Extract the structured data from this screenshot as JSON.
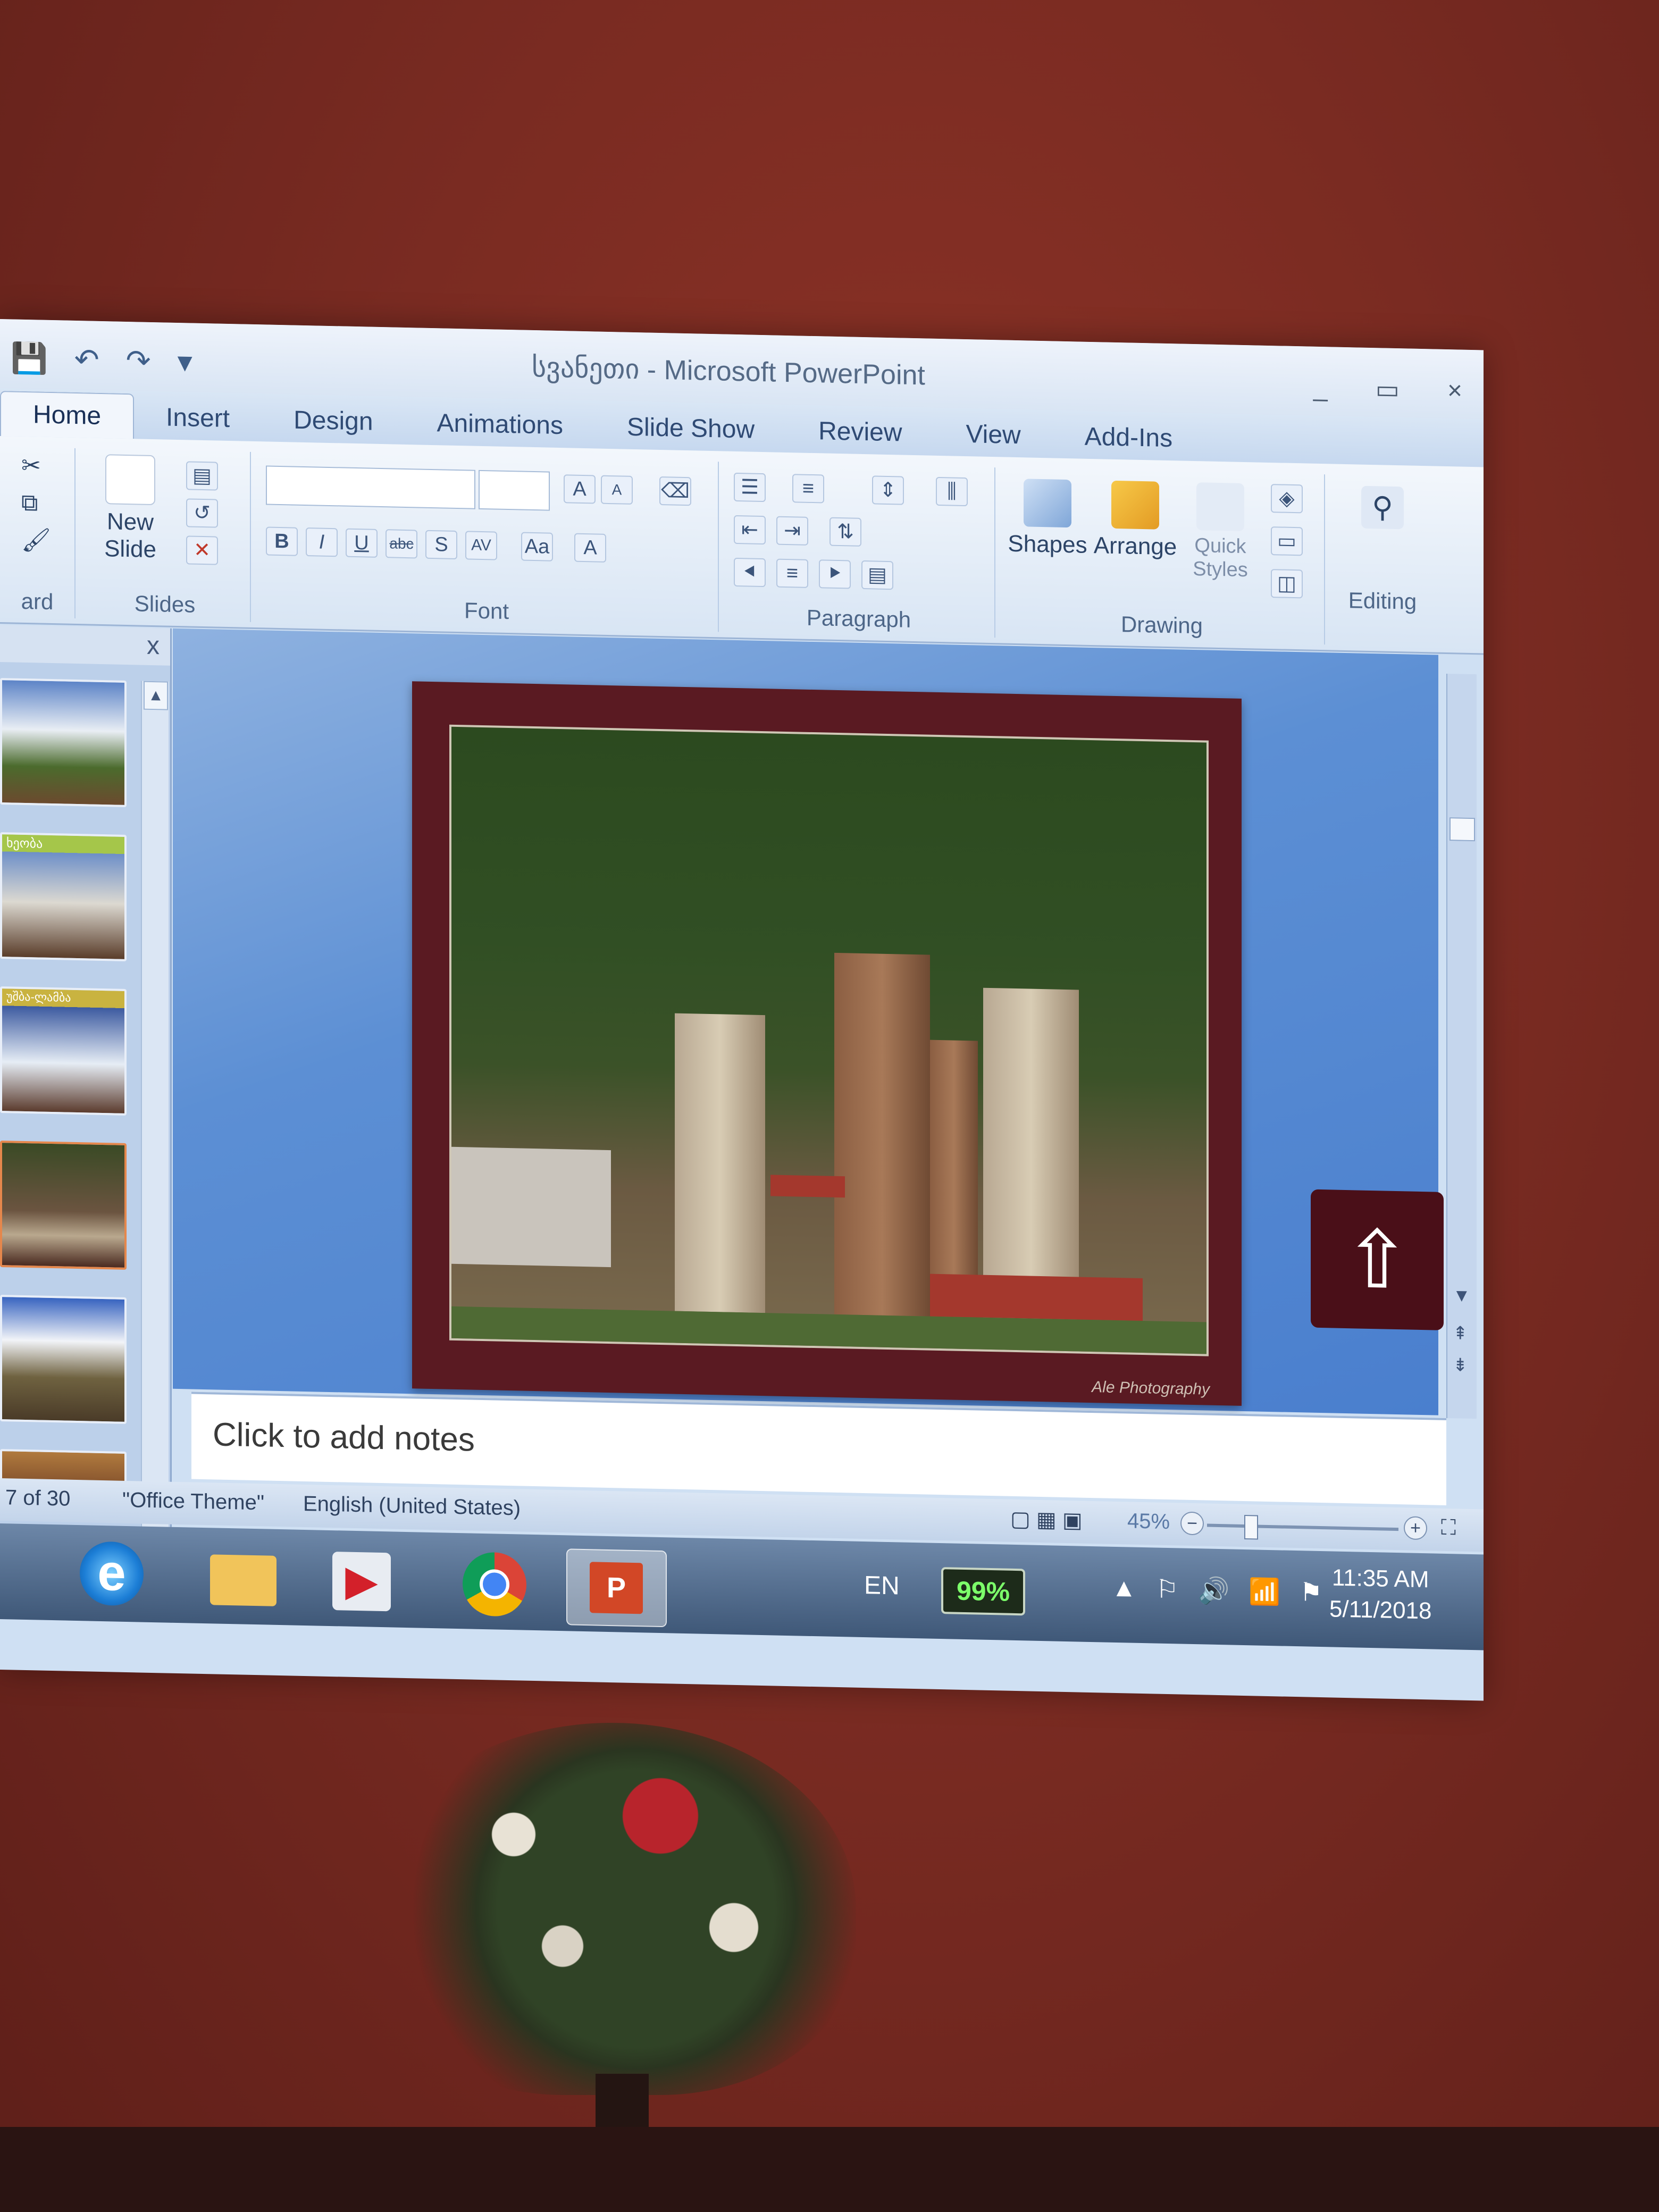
{
  "window": {
    "title": "სვანეთი - Microsoft PowerPoint",
    "controls": [
      "_",
      "▭",
      "×"
    ]
  },
  "quick_access": [
    "💾",
    "↶",
    "↷",
    "▾"
  ],
  "ribbon_tabs": [
    "Home",
    "Insert",
    "Design",
    "Animations",
    "Slide Show",
    "Review",
    "View",
    "Add-Ins"
  ],
  "ribbon": {
    "clipboard_label": "ard",
    "slides": {
      "new_slide": "New Slide",
      "label": "Slides"
    },
    "font": {
      "label": "Font",
      "buttons": [
        "B",
        "I",
        "U",
        "abc",
        "S",
        "AV",
        "Aa",
        "A"
      ],
      "grow": "A",
      "shrink": "A"
    },
    "paragraph": {
      "label": "Paragraph"
    },
    "drawing": {
      "shapes": "Shapes",
      "arrange": "Arrange",
      "quick_styles": "Quick Styles",
      "label": "Drawing"
    },
    "editing": {
      "label": "Editing"
    }
  },
  "slides_pane": {
    "close": "x",
    "thumb_labels": [
      "",
      "ხეობა",
      "უშბა-ლამბა",
      "",
      "",
      ""
    ]
  },
  "slide": {
    "signature": "Ale Photography",
    "home_button_glyph": "⇧"
  },
  "notes": {
    "placeholder": "Click to add notes"
  },
  "status": {
    "slide_counter": "7 of 30",
    "theme": "\"Office Theme\"",
    "language": "English (United States)",
    "zoom": "45%"
  },
  "taskbar": {
    "lang": "EN",
    "battery": "99%",
    "time": "11:35 AM",
    "date": "5/11/2018",
    "tray_icons": [
      "▲",
      "⚐",
      "🔊",
      "📶",
      "⚑"
    ]
  }
}
